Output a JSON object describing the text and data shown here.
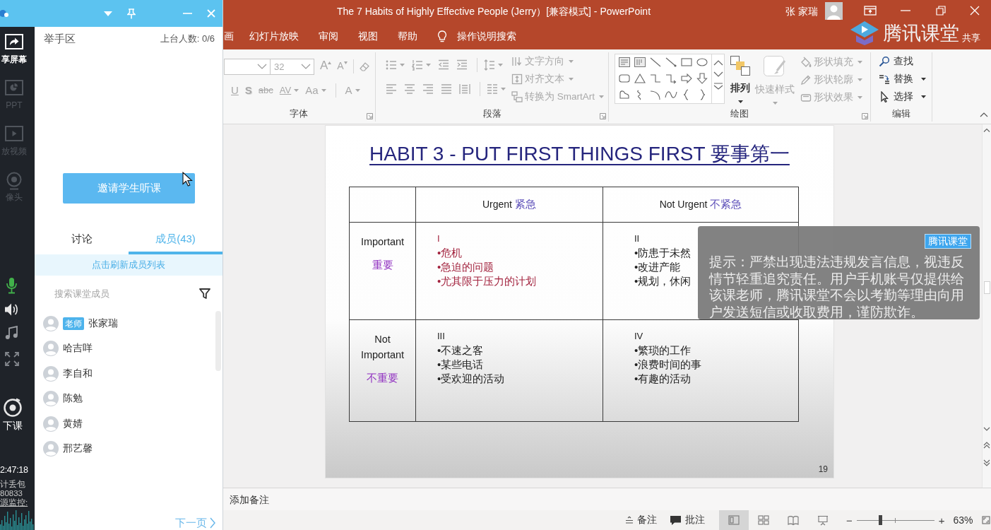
{
  "powerpoint": {
    "title_bar": {
      "title": "The 7 Habits of Highly Effective People (Jerry）[兼容模式] - PowerPoint",
      "user": "张 家瑞"
    },
    "tabs": [
      {
        "label": "画",
        "selected": false
      },
      {
        "label": "幻灯片放映",
        "selected": false
      },
      {
        "label": "审阅",
        "selected": false
      },
      {
        "label": "视图",
        "selected": false
      },
      {
        "label": "帮助",
        "selected": false
      }
    ],
    "tell_me": "操作说明搜索",
    "share": "共享",
    "ribbon": {
      "font": {
        "label": "字体",
        "font_size": "32",
        "size_buttons": [
          {
            "kind": "grow",
            "label": "A",
            "disabled": true
          },
          {
            "kind": "shrink",
            "label": "A",
            "disabled": true
          }
        ],
        "format_buttons": [
          {
            "kind": "underline",
            "label": "U",
            "dropdown": false,
            "disabled": true
          },
          {
            "kind": "shadow",
            "label": "S",
            "dropdown": false,
            "disabled": true
          },
          {
            "kind": "strike",
            "label": "abc",
            "dropdown": false,
            "disabled": true
          },
          {
            "kind": "spacing",
            "label": "AV",
            "dropdown": true,
            "disabled": true
          },
          {
            "kind": "case",
            "label": "Aa",
            "dropdown": true,
            "disabled": true
          },
          {
            "kind": "color",
            "label": "A",
            "dropdown": true,
            "disabled": true
          }
        ]
      },
      "paragraph": {
        "label": "段落",
        "icon_rows": [
          [
            {
              "kind": "bullets",
              "dropdown": true,
              "disabled": true
            },
            {
              "kind": "numbering",
              "dropdown": true,
              "disabled": true
            },
            {
              "kind": "outdent",
              "dropdown": false,
              "disabled": true
            },
            {
              "kind": "indent",
              "dropdown": false,
              "disabled": true
            },
            {
              "kind": "line_spacing",
              "dropdown": true,
              "disabled": true
            }
          ],
          [
            {
              "kind": "align_left",
              "dropdown": false,
              "disabled": true
            },
            {
              "kind": "align_center",
              "dropdown": false,
              "disabled": true
            },
            {
              "kind": "align_right",
              "dropdown": false,
              "disabled": true
            },
            {
              "kind": "justify",
              "dropdown": false,
              "disabled": true
            },
            {
              "kind": "distribute",
              "dropdown": false,
              "disabled": true
            },
            {
              "kind": "columns",
              "dropdown": true,
              "disabled": true
            }
          ]
        ],
        "text_buttons": [
          {
            "kind": "text_direction",
            "label": "文字方向",
            "disabled": true
          },
          {
            "kind": "align_text",
            "label": "对齐文本",
            "disabled": true
          },
          {
            "kind": "smartart",
            "label": "转换为 SmartArt",
            "disabled": true
          }
        ]
      },
      "drawing": {
        "label": "绘图",
        "arrange": {
          "label": "排列",
          "disabled": false
        },
        "quick_styles": {
          "label": "快速样式",
          "disabled": true
        },
        "shape_buttons": [
          {
            "kind": "fill",
            "label": "形状填充",
            "disabled": true
          },
          {
            "kind": "outline",
            "label": "形状轮廓",
            "disabled": true
          },
          {
            "kind": "effects",
            "label": "形状效果",
            "disabled": true
          }
        ]
      },
      "editing": {
        "label": "编辑",
        "buttons": [
          {
            "kind": "find",
            "label": "查找",
            "dropdown": false
          },
          {
            "kind": "replace",
            "label": "替换",
            "dropdown": true
          },
          {
            "kind": "select",
            "label": "选择",
            "dropdown": true
          }
        ]
      }
    },
    "slide": {
      "title": "HABIT 3 - PUT FIRST THINGS FIRST 要事第一",
      "columns": [
        {
          "en": "Urgent",
          "zh": "紧急"
        },
        {
          "en": "Not Urgent",
          "zh": "不紧急"
        }
      ],
      "rows": [
        {
          "en": "Important",
          "zh": "重要",
          "cells": [
            {
              "numeral": "I",
              "highlighted": true,
              "items": [
                "•危机",
                "•急迫的问题",
                "•尤其限于压力的计划"
              ]
            },
            {
              "numeral": "II",
              "highlighted": false,
              "items": [
                "•防患于未然",
                "•改进产能",
                "•规划，休闲"
              ]
            }
          ]
        },
        {
          "en": "Not Important",
          "zh": "不重要",
          "cells": [
            {
              "numeral": "III",
              "highlighted": false,
              "items": [
                "•不速之客",
                "•某些电话",
                "•受欢迎的活动"
              ]
            },
            {
              "numeral": "IV",
              "highlighted": false,
              "items": [
                "•繁琐的工作",
                "•浪费时间的事",
                "•有趣的活动"
              ]
            }
          ]
        }
      ],
      "number": "19"
    },
    "notice": {
      "badge": "腾讯课堂",
      "text": "提示：严禁出现违法违规发言信息，视违反情节轻重追究责任。用户手机账号仅提供给该课老师，腾讯课堂不会以考勤等理由向用户发送短信或收取费用，谨防欺诈。"
    },
    "notes": {
      "placeholder": "添加备注"
    },
    "status_bar": {
      "notes_button": "备注",
      "comments_button": "批注",
      "views": [
        {
          "kind": "normal",
          "selected": true
        },
        {
          "kind": "sorter",
          "selected": false
        },
        {
          "kind": "reading",
          "selected": false
        },
        {
          "kind": "slideshow",
          "selected": false
        }
      ],
      "zoom_out": "−",
      "zoom": {
        "level": 0.3
      },
      "zoom_in": "+",
      "zoom_percent": "63%"
    }
  },
  "logo": {
    "text": "腾讯课堂"
  },
  "classroom": {
    "toolbar": {
      "tools": [
        {
          "kind": "share",
          "label": "享屏幕",
          "disabled": false
        },
        {
          "kind": "ppt",
          "label": "PPT",
          "disabled": true
        },
        {
          "kind": "video",
          "label": "放视频",
          "disabled": true
        },
        {
          "kind": "camera",
          "label": "像头",
          "disabled": true
        }
      ],
      "mic_on": true,
      "end_class": "下课",
      "time": "2:47:18",
      "packet_loss_label": "计丢包",
      "packet_loss": "80833",
      "monitor_link": "源监控:"
    },
    "hands_up": {
      "title": "举手区",
      "count": "上台人数: 0/6"
    },
    "invite_button": "邀请学生听课",
    "tabs": [
      {
        "label": "讨论",
        "selected": false
      },
      {
        "label": "成员(43)",
        "selected": true
      }
    ],
    "refresh": "点击刷新成员列表",
    "search": {
      "placeholder": "搜索课堂成员"
    },
    "members": [
      {
        "name": "张家瑞",
        "badge": "老师"
      },
      {
        "name": "哈吉咩"
      },
      {
        "name": "李自和"
      },
      {
        "name": "陈勉"
      },
      {
        "name": "黄婧"
      },
      {
        "name": "邢艺馨"
      }
    ],
    "next_page": "下一页"
  }
}
